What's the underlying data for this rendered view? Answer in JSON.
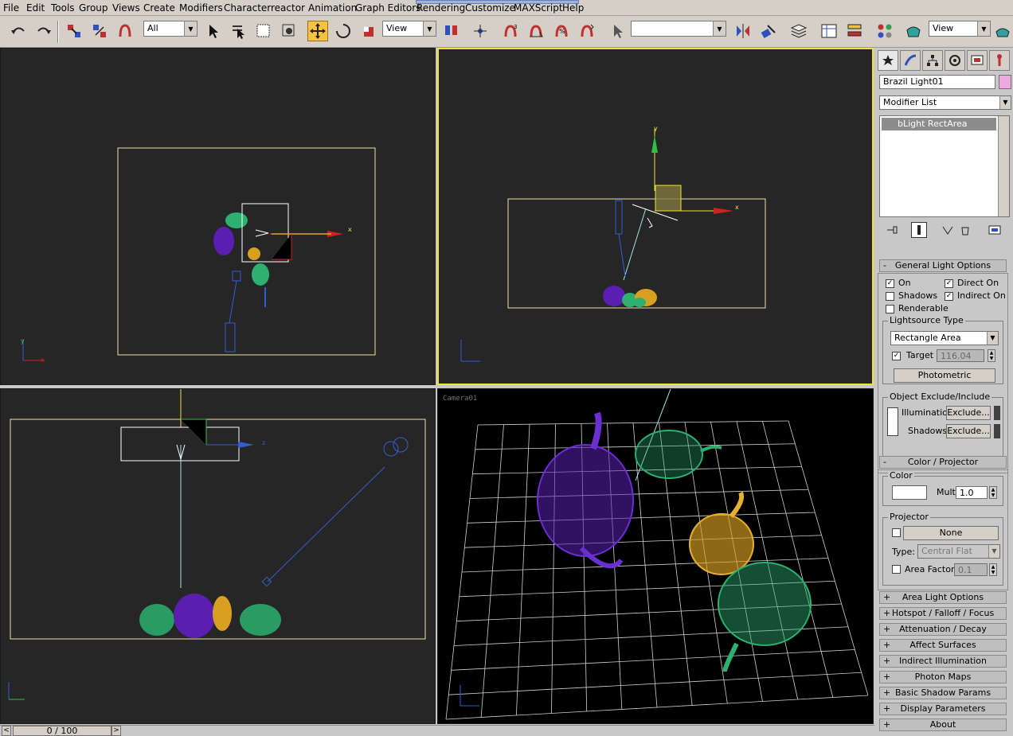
{
  "menu": {
    "items": [
      "File",
      "Edit",
      "Tools",
      "Group",
      "Views",
      "Create",
      "Modifiers",
      "Character",
      "reactor",
      "Animation",
      "Graph Editors",
      "Rendering",
      "Customize",
      "MAXScript",
      "Help"
    ]
  },
  "toolbar": {
    "selection_filter": "All",
    "ref_coord_1": "View",
    "named_selection": "",
    "ref_coord_2": "View"
  },
  "viewports": {
    "top_left": {
      "axis_x": "x",
      "axis_y": "y"
    },
    "top_right": {
      "axis_y": "y",
      "axis_x": "x"
    },
    "bottom_left": {
      "axis_z": "z"
    },
    "bottom_right": {
      "label": "Camera01"
    }
  },
  "command_panel": {
    "object_name": "Brazil Light01",
    "object_color": "#f0a8e0",
    "modifier_list": "Modifier List",
    "stack_item": "bLight RectArea",
    "general_light_options": {
      "title": "General Light Options",
      "toggle": "-",
      "on_label": "On",
      "direct_on_label": "Direct On",
      "shadows_label": "Shadows",
      "indirect_on_label": "Indirect On",
      "renderable_label": "Renderable",
      "lightsource_type_label": "Lightsource Type",
      "lightsource_type_value": "Rectangle Area",
      "target_label": "Target",
      "target_value": "116.04",
      "photometric_button": "Photometric",
      "exclude_group_label": "Object Exclude/Include",
      "illumination_label": "Illumination",
      "shadows_exclude_label": "Shadows",
      "exclude_button_1": "Exclude...",
      "exclude_button_2": "Exclude..."
    },
    "color_projector": {
      "title": "Color / Projector",
      "toggle": "-",
      "color_label": "Color",
      "mult_label": "Mult",
      "mult_value": "1.0",
      "projector_label": "Projector",
      "projector_map": "None",
      "type_label": "Type:",
      "type_value": "Central Flat",
      "area_factor_label": "Area Factor:",
      "area_factor_value": "0.1"
    },
    "collapsed_rollouts": [
      "Area Light Options",
      "Hotspot / Falloff / Focus",
      "Attenuation / Decay",
      "Affect Surfaces",
      "Indirect Illumination",
      "Photon Maps",
      "Basic Shadow Params",
      "Display Parameters",
      "About"
    ],
    "collapsed_toggle": "+"
  },
  "timeline": {
    "frame_display": "0 / 100",
    "prev_arrow": "<",
    "next_arrow": ">"
  }
}
